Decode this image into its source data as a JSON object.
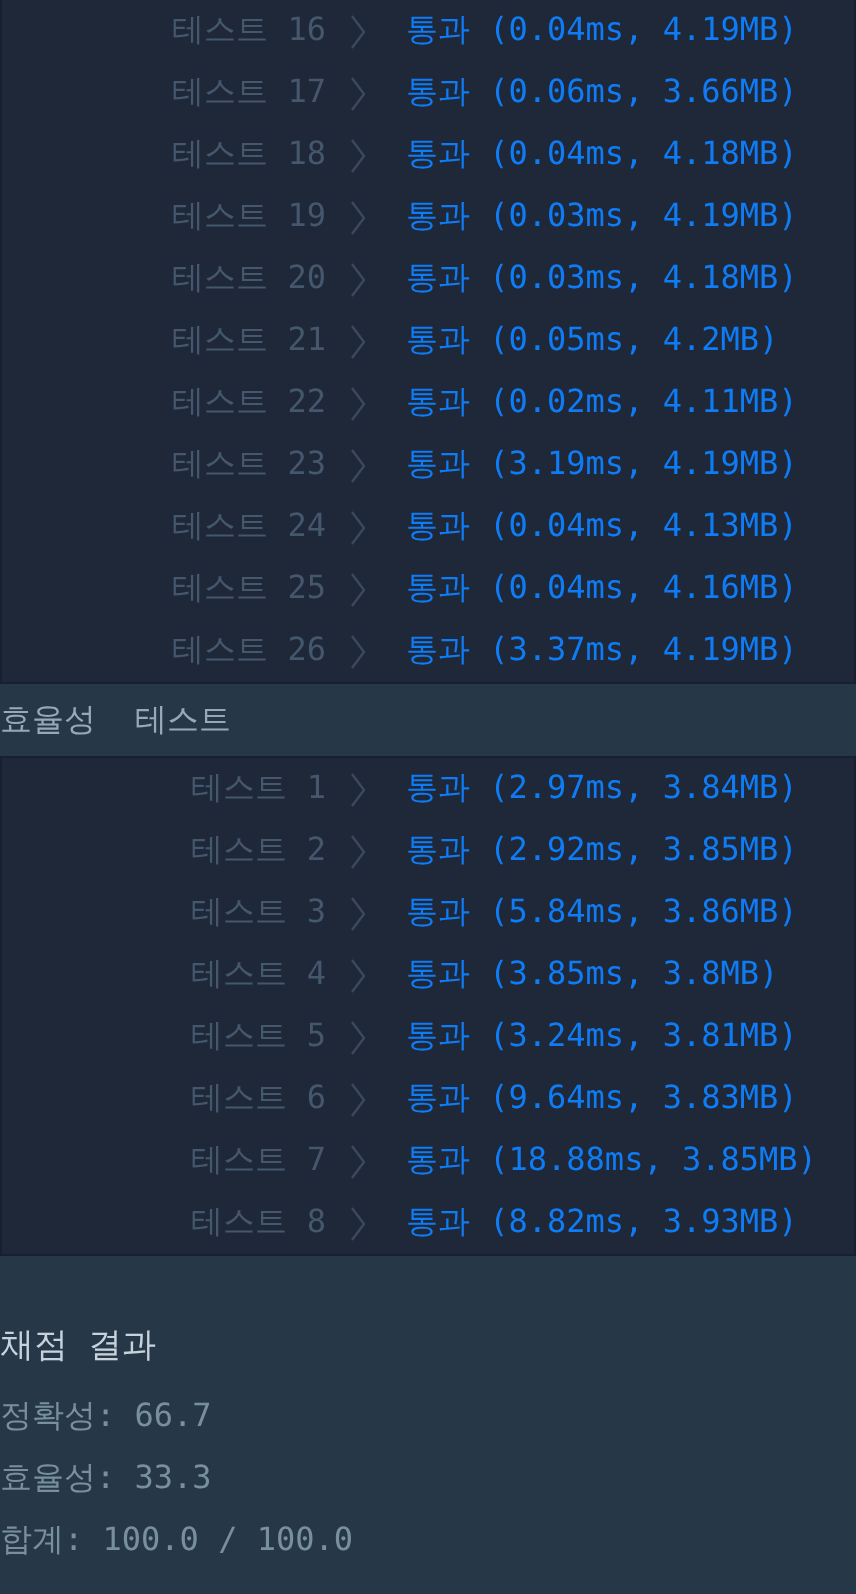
{
  "accuracy_tests": [
    {
      "label": "테스트 16",
      "result": "통과 (0.04ms, 4.19MB)"
    },
    {
      "label": "테스트 17",
      "result": "통과 (0.06ms, 3.66MB)"
    },
    {
      "label": "테스트 18",
      "result": "통과 (0.04ms, 4.18MB)"
    },
    {
      "label": "테스트 19",
      "result": "통과 (0.03ms, 4.19MB)"
    },
    {
      "label": "테스트 20",
      "result": "통과 (0.03ms, 4.18MB)"
    },
    {
      "label": "테스트 21",
      "result": "통과 (0.05ms, 4.2MB)"
    },
    {
      "label": "테스트 22",
      "result": "통과 (0.02ms, 4.11MB)"
    },
    {
      "label": "테스트 23",
      "result": "통과 (3.19ms, 4.19MB)"
    },
    {
      "label": "테스트 24",
      "result": "통과 (0.04ms, 4.13MB)"
    },
    {
      "label": "테스트 25",
      "result": "통과 (0.04ms, 4.16MB)"
    },
    {
      "label": "테스트 26",
      "result": "통과 (3.37ms, 4.19MB)"
    }
  ],
  "efficiency_section": {
    "title": "효율성  테스트"
  },
  "efficiency_tests": [
    {
      "label": "테스트 1",
      "result": "통과 (2.97ms, 3.84MB)"
    },
    {
      "label": "테스트 2",
      "result": "통과 (2.92ms, 3.85MB)"
    },
    {
      "label": "테스트 3",
      "result": "통과 (5.84ms, 3.86MB)"
    },
    {
      "label": "테스트 4",
      "result": "통과 (3.85ms, 3.8MB)"
    },
    {
      "label": "테스트 5",
      "result": "통과 (3.24ms, 3.81MB)"
    },
    {
      "label": "테스트 6",
      "result": "통과 (9.64ms, 3.83MB)"
    },
    {
      "label": "테스트 7",
      "result": "통과 (18.88ms, 3.85MB)"
    },
    {
      "label": "테스트 8",
      "result": "통과 (8.82ms, 3.93MB)"
    }
  ],
  "grading": {
    "title": "채점 결과",
    "lines": [
      "정확성: 66.7",
      "효율성: 33.3",
      "합계: 100.0 / 100.0"
    ]
  }
}
